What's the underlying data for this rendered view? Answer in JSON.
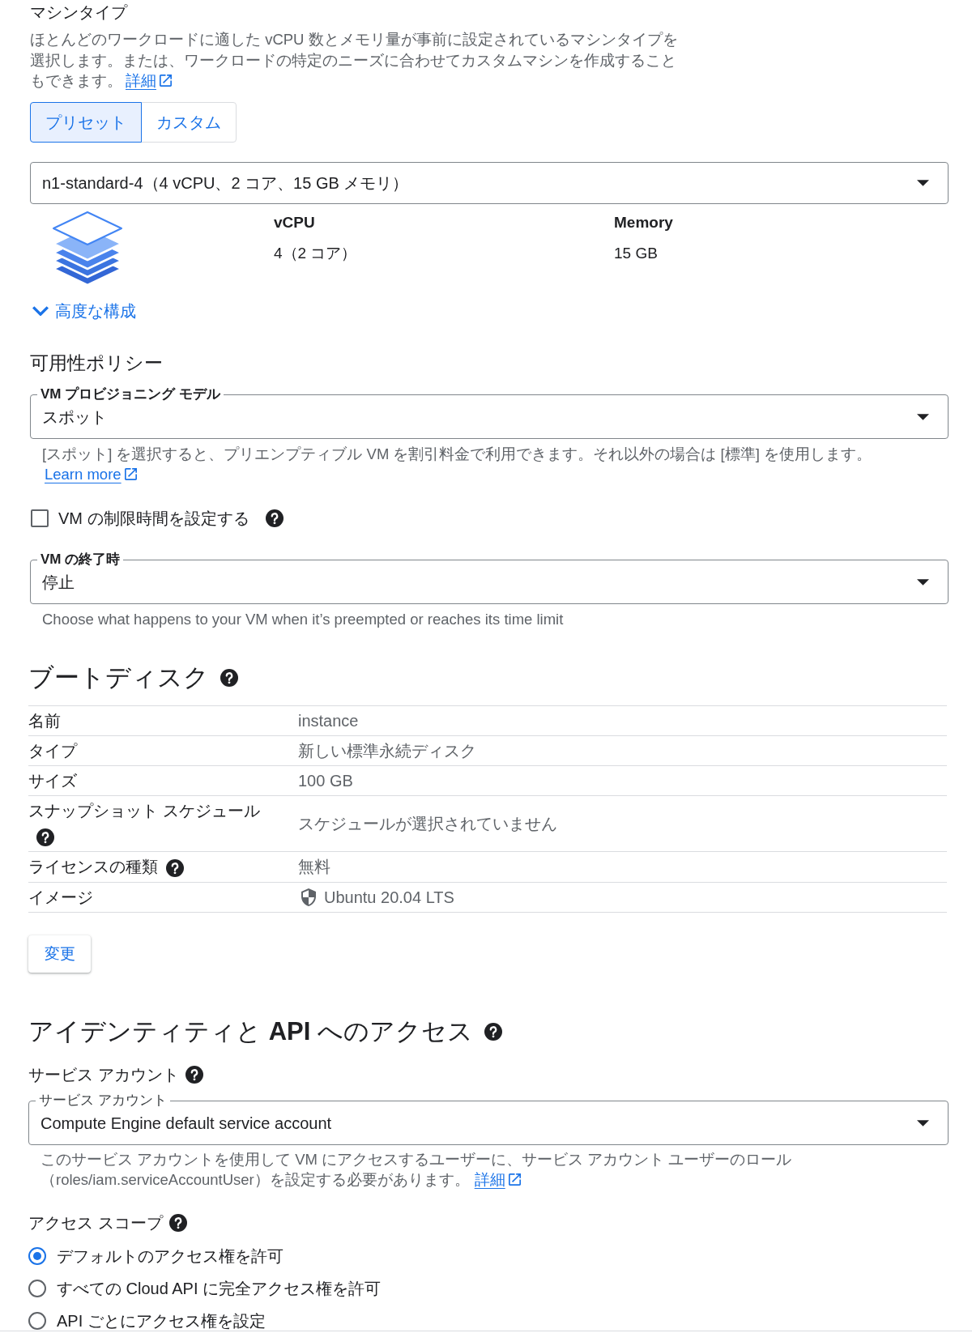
{
  "machine_type": {
    "title": "マシンタイプ",
    "description": "ほとんどのワークロードに適した vCPU 数とメモリ量が事前に設定されているマシンタイプを選択します。または、ワークロードの特定のニーズに合わせてカスタムマシンを作成することもできます。",
    "link": "詳細",
    "tabs": [
      {
        "label": "プリセット",
        "selected": true
      },
      {
        "label": "カスタム",
        "selected": false
      }
    ],
    "select": {
      "value": "n1-standard-4（4 vCPU、2 コア、15 GB メモリ）"
    },
    "specs": [
      {
        "label": "vCPU",
        "value": "4（2 コア）"
      },
      {
        "label": "Memory",
        "value": "15 GB"
      }
    ],
    "advanced": {
      "label": "高度な構成",
      "expanded": false
    }
  },
  "availability_policy": {
    "title": "可用性ポリシー",
    "provisioning_model": {
      "label": "VM プロビジョニング モデル",
      "value": "スポット",
      "help": "[スポット] を選択すると、プリエンプティブル VM を割引料金で利用できます。それ以外の場合は [標準] を使用します。",
      "link": "Learn more"
    },
    "time_limit": {
      "label": "VM の制限時間を設定する",
      "checked": false
    },
    "termination": {
      "label": "VM の終了時",
      "value": "停止",
      "help": "Choose what happens to your VM when it’s preempted or reaches its time limit"
    }
  },
  "boot_disk": {
    "title": "ブートディスク",
    "rows": [
      {
        "kind": "plain",
        "label": "名前",
        "value": "instance"
      },
      {
        "kind": "plain",
        "label": "タイプ",
        "value": "新しい標準永続ディスク"
      },
      {
        "kind": "plain",
        "label": "サイズ",
        "value": "100 GB"
      },
      {
        "kind": "help",
        "label": "スナップショット スケジュール",
        "value": "スケジュールが選択されていません"
      },
      {
        "kind": "help",
        "label": "ライセンスの種類",
        "value": "無料"
      },
      {
        "kind": "image",
        "label": "イメージ",
        "value": "Ubuntu 20.04 LTS"
      }
    ],
    "button": "変更"
  },
  "identity_api_access": {
    "title": "アイデンティティと **API** へのアクセス",
    "service_account": {
      "title": "サービス アカウント",
      "label": "サービス アカウント",
      "value": "Compute Engine default service account",
      "help": "このサービス アカウントを使用して VM にアクセスするユーザーに、サービス アカウント ユーザーのロール（roles/iam.serviceAccountUser）を設定する必要があります。",
      "link": "詳細"
    },
    "access_scope": {
      "title": "アクセス スコープ",
      "options": [
        {
          "label": "デフォルトのアクセス権を許可",
          "selected": true
        },
        {
          "label": "すべての Cloud API に完全アクセス権を許可",
          "selected": false
        },
        {
          "label": "API ごとにアクセス権を設定",
          "selected": false
        }
      ]
    }
  }
}
